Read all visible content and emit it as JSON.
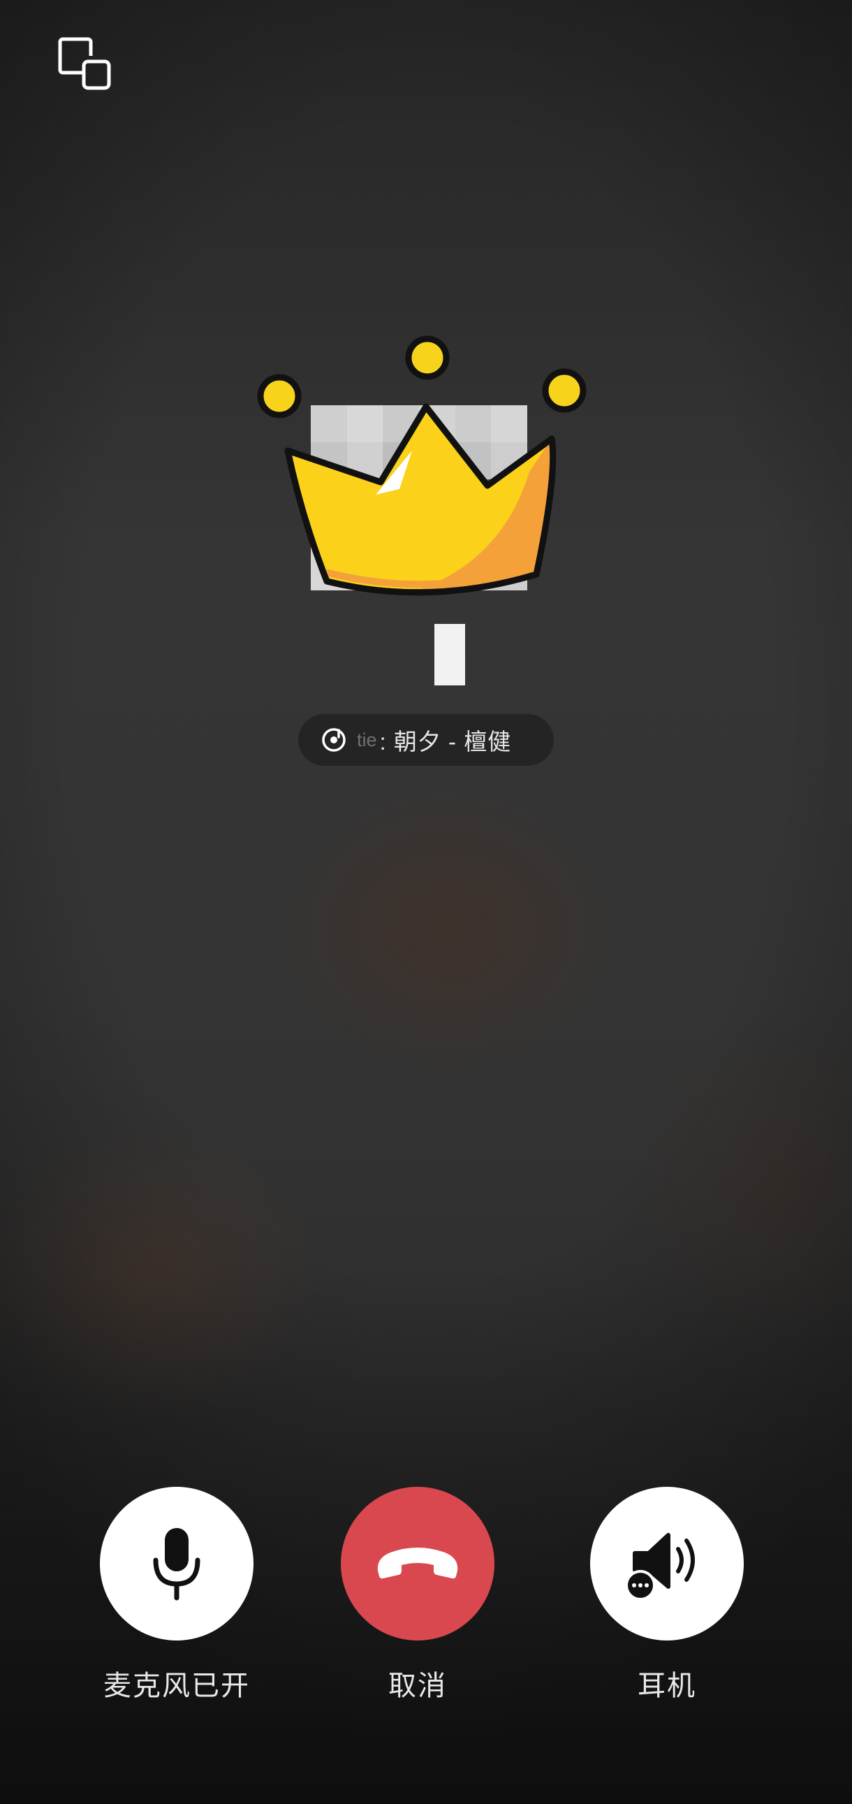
{
  "top_bar": {
    "float_window_icon": "floating-window-icon"
  },
  "caller": {
    "avatar_icon": "crown-icon",
    "name_block_color": "#f2f2f2"
  },
  "music": {
    "icon": "music-disc-icon",
    "prefix": "tie",
    "text": ": 朝夕 - 檀健"
  },
  "controls": {
    "mic": {
      "label": "麦克风已开",
      "icon": "microphone-icon"
    },
    "cancel": {
      "label": "取消",
      "icon": "hang-up-icon",
      "color": "#d9484e"
    },
    "earpiece": {
      "label": "耳机",
      "icon": "speaker-earpiece-icon"
    }
  }
}
